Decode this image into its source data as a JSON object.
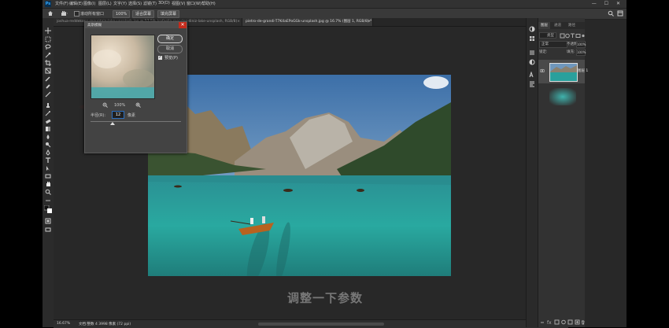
{
  "app": {
    "logo": "Ps"
  },
  "menu": [
    "文件(F)",
    "编辑(E)",
    "图像(I)",
    "图层(L)",
    "文字(Y)",
    "选择(S)",
    "滤镜(T)",
    "3D(D)",
    "视图(V)",
    "窗口(W)",
    "帮助(H)"
  ],
  "window_controls": "— ☐ ✕",
  "options_bar": {
    "checkbox_label": "滚动所有窗口",
    "zoom_value": "100%",
    "fit_button": "适合屏幕",
    "fill_button": "填充屏幕"
  },
  "tabs": [
    {
      "label": "joshua-reddekopp-mountain-lake-unsplash.jpg @ 57.5% (rafaella-mendes-diniz-lake-unsplash, RGB/8)",
      "close": "×"
    },
    {
      "label": "pietro-de-grandi-T7K4aEPoGGk-unsplash.jpg @ 16.7% (图层 1, RGB/8) *",
      "close": "×"
    }
  ],
  "status": {
    "zoom": "16.67%",
    "doc": "文档:整数 4 3998 像素 (72 ppi)"
  },
  "caption": "调整一下参数",
  "dialog": {
    "title": "高斯模糊",
    "close": "✕",
    "ok": "确定",
    "cancel": "取消",
    "preview_check": "✓",
    "preview_label": "预览(P)",
    "zoom_value": "100%",
    "radius_label": "半径(R):",
    "radius_value": "12",
    "radius_unit": "像素",
    "slider_fraction": 0.24
  },
  "layers_panel": {
    "tabs": [
      "图层",
      "通道",
      "路径"
    ],
    "filter_label": "类型",
    "blend_mode": "正常",
    "opacity_label": "不透明度:",
    "opacity_value": "100%",
    "lock_label": "锁定:",
    "fill_label": "填充:",
    "fill_value": "100%",
    "layers": [
      {
        "name": "图层 1"
      },
      {
        "name": ""
      }
    ]
  },
  "colors": {
    "accent": "#31a8ff",
    "close_red": "#c42b1c",
    "bg": "#282828"
  }
}
